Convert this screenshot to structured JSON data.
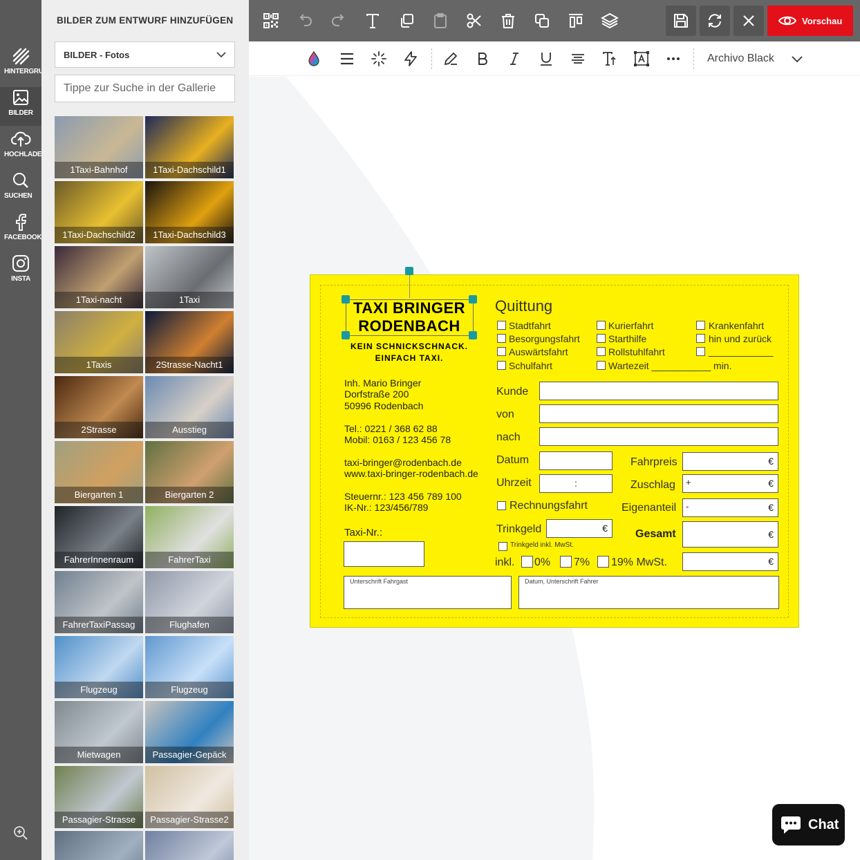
{
  "rail": {
    "items": [
      {
        "label": "HINTERGRUND",
        "icon": "background-stripes-icon"
      },
      {
        "label": "BILDER",
        "icon": "image-icon"
      },
      {
        "label": "HOCHLADEN",
        "icon": "upload-cloud-icon"
      },
      {
        "label": "SUCHEN",
        "icon": "search-icon"
      },
      {
        "label": "FACEBOOK",
        "icon": "facebook-icon"
      },
      {
        "label": "INSTA",
        "icon": "instagram-icon"
      }
    ],
    "zoom_icon": "zoom-in-icon"
  },
  "panel": {
    "title": "BILDER ZUM ENTWURF HINZUFÜGEN",
    "select_value": "BILDER - Fotos",
    "search_placeholder": "Tippe zur Suche in der Gallerie",
    "tiles": [
      {
        "label": "1Taxi-Bahnhof",
        "colors": [
          "#8b9bb0",
          "#c9b894"
        ]
      },
      {
        "label": "1Taxi-Dachschild1",
        "colors": [
          "#1e2a5a",
          "#e8b020"
        ]
      },
      {
        "label": "1Taxi-Dachschild2",
        "colors": [
          "#6b5a2a",
          "#e8c030"
        ]
      },
      {
        "label": "1Taxi-Dachschild3",
        "colors": [
          "#1a1410",
          "#e0a010"
        ]
      },
      {
        "label": "1Taxi-nacht",
        "colors": [
          "#3a2a3a",
          "#c0a070"
        ]
      },
      {
        "label": "1Taxi",
        "colors": [
          "#bfc4c8",
          "#6a6e72"
        ]
      },
      {
        "label": "1Taxis",
        "colors": [
          "#8a7f6a",
          "#d0b040"
        ]
      },
      {
        "label": "2Strasse-Nacht1",
        "colors": [
          "#0a1a3a",
          "#d08030"
        ]
      },
      {
        "label": "2Strasse",
        "colors": [
          "#4a2810",
          "#c08a50"
        ]
      },
      {
        "label": "Ausstieg",
        "colors": [
          "#6a8ab0",
          "#d8d0c8"
        ]
      },
      {
        "label": "Biergarten 1",
        "colors": [
          "#a0a080",
          "#d0a060"
        ]
      },
      {
        "label": "Biergarten 2",
        "colors": [
          "#607040",
          "#d0a070"
        ]
      },
      {
        "label": "FahrerInnenraum",
        "colors": [
          "#202428",
          "#7a8088"
        ]
      },
      {
        "label": "FahrerTaxi",
        "colors": [
          "#90b060",
          "#e0e0e0"
        ]
      },
      {
        "label": "FahrerTaxiPassag",
        "colors": [
          "#708090",
          "#c0c4c8"
        ]
      },
      {
        "label": "Flughafen",
        "colors": [
          "#9098a8",
          "#d0d4dc"
        ]
      },
      {
        "label": "Flugzeug",
        "colors": [
          "#5090c8",
          "#c0d8f0"
        ]
      },
      {
        "label": "Flugzeug",
        "colors": [
          "#6098d0",
          "#c8e0f8"
        ]
      },
      {
        "label": "Mietwagen",
        "colors": [
          "#808890",
          "#c0c8d0"
        ]
      },
      {
        "label": "Passagier-Gepäck",
        "colors": [
          "#c8c4c0",
          "#3080c0"
        ]
      },
      {
        "label": "Passagier-Strasse",
        "colors": [
          "#708050",
          "#c0c8d0"
        ]
      },
      {
        "label": "Passagier-Strasse2",
        "colors": [
          "#d0c0a0",
          "#f0e8e0"
        ]
      },
      {
        "label": "",
        "colors": [
          "#607080",
          "#a0b0c0"
        ]
      },
      {
        "label": "",
        "colors": [
          "#7080a0",
          "#c0c8d8"
        ]
      }
    ]
  },
  "toolbar": {
    "icons": [
      "qr-code-icon",
      "undo-icon",
      "redo-icon",
      "text-icon",
      "copy-icon",
      "paste-icon",
      "cut-icon",
      "delete-icon",
      "duplicate-icon",
      "align-top-icon",
      "layers-icon"
    ],
    "save_icon": "save-icon",
    "refresh_icon": "refresh-icon",
    "close_icon": "close-icon",
    "preview_label": "Vorschau"
  },
  "format": {
    "font_name": "Archivo Black"
  },
  "card": {
    "logo_line1": "TAXI BRINGER",
    "logo_line2": "RODENBACH",
    "slogan_line1": "KEIN SCHNICKSCHNACK.",
    "slogan_line2": "EINFACH TAXI.",
    "owner": "Inh. Mario Bringer",
    "street": "Dorfstraße 200",
    "city": "50996 Rodenbach",
    "tel": "Tel.: 0221 / 368 62 88",
    "mobil": "Mobil: 0163 / 123 456 78",
    "email": "taxi-bringer@rodenbach.de",
    "web": "www.taxi-bringer-rodenbach.de",
    "steuer": "Steuernr.: 123 456 789 100",
    "ik": "IK-Nr.: 123/456/789",
    "taxi_nr": "Taxi-Nr.:",
    "quittung": "Quittung",
    "checks_col1": [
      "Stadtfahrt",
      "Besorgungsfahrt",
      "Auswärtsfahrt",
      "Schulfahrt"
    ],
    "checks_col2": [
      "Kurierfahrt",
      "Starthilfe",
      "Rollstuhlfahrt",
      "Wartezeit ___________ min."
    ],
    "checks_col3": [
      "Krankenfahrt",
      "hin und zurück",
      "____________"
    ],
    "kunde": "Kunde",
    "von": "von",
    "nach": "nach",
    "datum": "Datum",
    "uhrzeit": "Uhrzeit",
    "uhrzeit_sep": ":",
    "fahrpreis": "Fahrpreis",
    "zuschlag": "Zuschlag",
    "eigenanteil": "Eigenanteil",
    "gesamt": "Gesamt",
    "rechnungsfahrt": "Rechnungsfahrt",
    "trinkgeld": "Trinkgeld",
    "trinkgeld_inkl": "Trinkgeld inkl. MwSt.",
    "inkl": "inkl.",
    "vat_0": "0%",
    "vat_7": "7%",
    "vat_19": "19% MwSt.",
    "euro": "€",
    "plus": "+",
    "minus": "-",
    "sig_guest": "Unterschrift Fahrgast",
    "sig_driver": "Datum, Unterschrift Fahrer"
  },
  "chat": {
    "label": "Chat"
  }
}
